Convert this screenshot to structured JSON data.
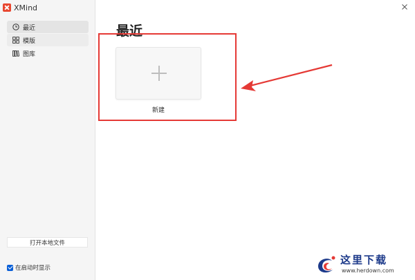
{
  "app": {
    "title": "XMind"
  },
  "sidebar": {
    "items": [
      {
        "label": "最近",
        "icon": "clock-icon",
        "state": "active"
      },
      {
        "label": "模版",
        "icon": "grid-icon",
        "state": "hover"
      },
      {
        "label": "图库",
        "icon": "library-icon",
        "state": "normal"
      }
    ],
    "open_local_file_label": "打开本地文件",
    "show_on_startup_label": "在启动时显示",
    "show_on_startup_checked": true
  },
  "main": {
    "title": "最近",
    "new_label": "新建"
  },
  "annotation": {
    "highlight_color": "#e53935"
  },
  "watermark": {
    "cn_text": "这里下载",
    "en_text": "www.herdown.com"
  },
  "colors": {
    "accent": "#0a5fd7",
    "brand": "#e8462f",
    "sidebar_bg": "#f5f5f5"
  }
}
